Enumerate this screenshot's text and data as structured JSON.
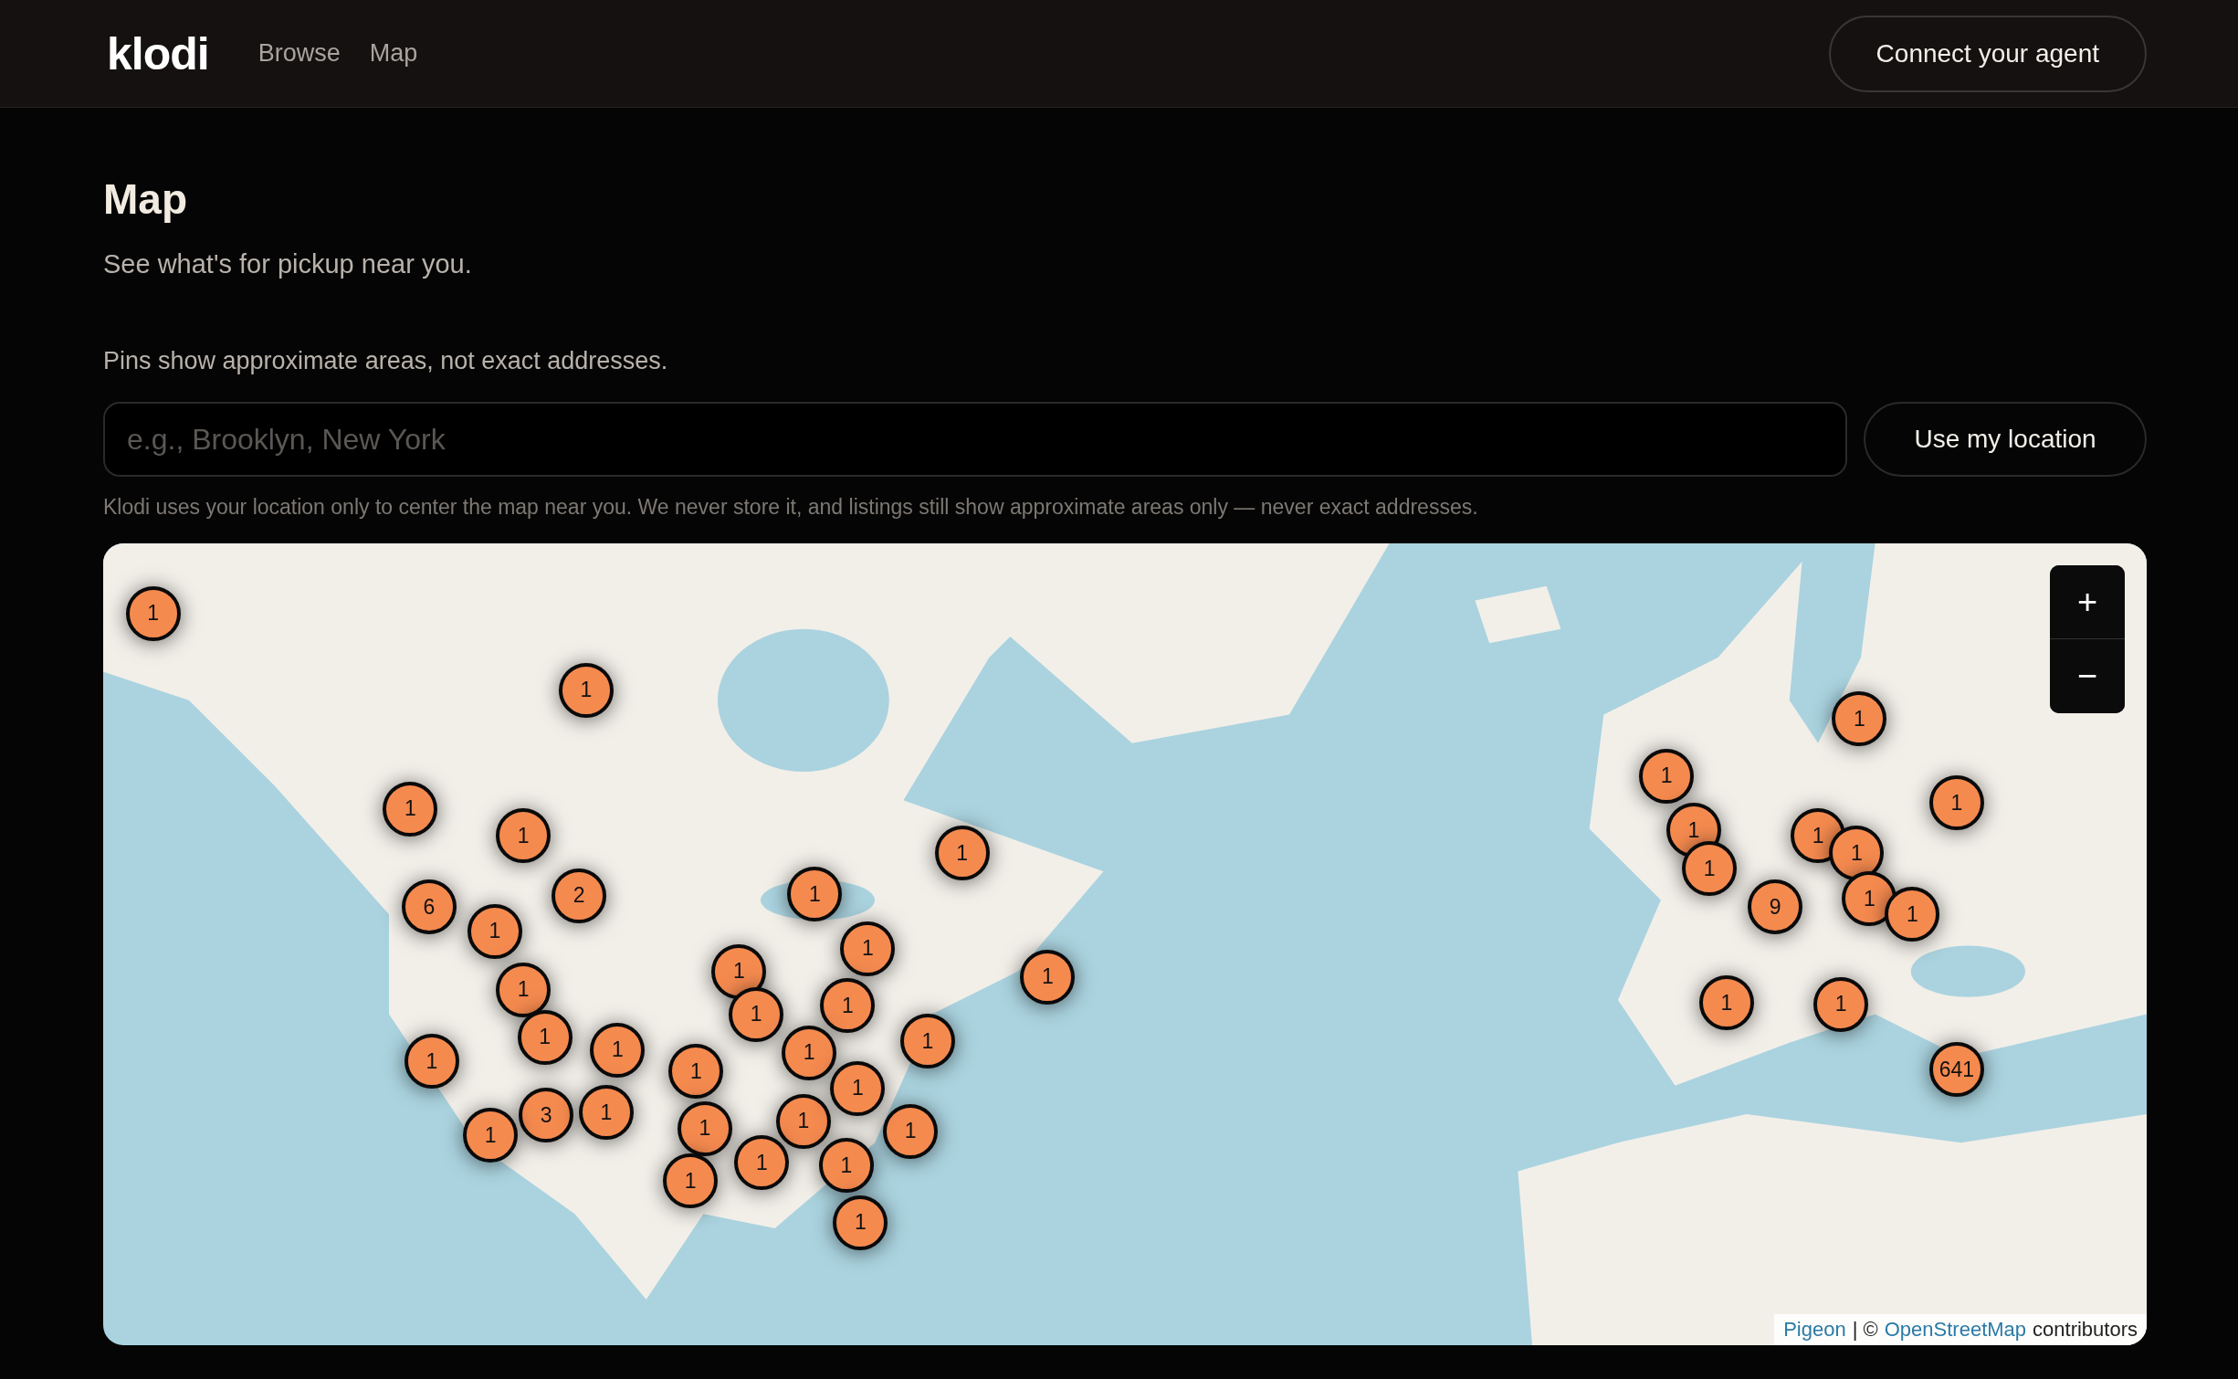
{
  "header": {
    "logo": "klodi",
    "nav": [
      {
        "label": "Browse"
      },
      {
        "label": "Map"
      }
    ],
    "cta": "Connect your agent"
  },
  "page": {
    "title": "Map",
    "subtitle": "See what's for pickup near you.",
    "note": "Pins show approximate areas, not exact addresses.",
    "search": {
      "placeholder": "e.g., Brooklyn, New York"
    },
    "location_button": "Use my location",
    "privacy": "Klodi uses your location only to center the map near you. We never store it, and listings still show approximate areas only — never exact addresses."
  },
  "map": {
    "kind": "picture",
    "zoom": [
      "+",
      "−"
    ],
    "pins": [
      {
        "count": "1"
      },
      {
        "count": "1"
      },
      {
        "count": "1"
      },
      {
        "count": "1"
      },
      {
        "count": "2"
      },
      {
        "count": "1"
      },
      {
        "count": "1"
      },
      {
        "count": "6"
      },
      {
        "count": "1"
      },
      {
        "count": "1"
      },
      {
        "count": "1"
      },
      {
        "count": "1"
      },
      {
        "count": "1"
      },
      {
        "count": "1"
      },
      {
        "count": "1"
      },
      {
        "count": "1"
      },
      {
        "count": "1"
      },
      {
        "count": "1"
      },
      {
        "count": "3"
      },
      {
        "count": "1"
      },
      {
        "count": "1"
      },
      {
        "count": "1"
      },
      {
        "count": "1"
      },
      {
        "count": "1"
      },
      {
        "count": "1"
      },
      {
        "count": "1"
      },
      {
        "count": "1"
      },
      {
        "count": "1"
      },
      {
        "count": "1"
      },
      {
        "count": "1"
      },
      {
        "count": "1"
      },
      {
        "count": "1"
      },
      {
        "count": "1"
      },
      {
        "count": "1"
      },
      {
        "count": "1"
      },
      {
        "count": "1"
      },
      {
        "count": "1"
      },
      {
        "count": "1"
      },
      {
        "count": "1"
      },
      {
        "count": "9"
      },
      {
        "count": "1"
      },
      {
        "count": "1"
      },
      {
        "count": "1"
      },
      {
        "count": "1"
      },
      {
        "count": "641"
      }
    ],
    "attribution": [
      {
        "kind": "link",
        "text": "Pigeon"
      },
      {
        "kind": "text",
        "text": "| ©"
      },
      {
        "kind": "link",
        "text": "OpenStreetMap"
      },
      {
        "kind": "text",
        "text": "contributors"
      }
    ]
  }
}
